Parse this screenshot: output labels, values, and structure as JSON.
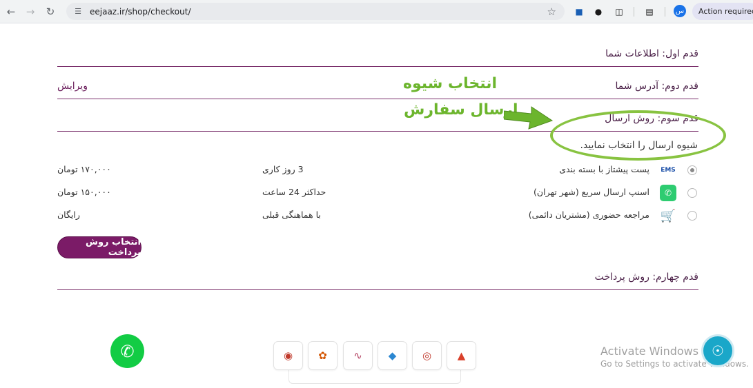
{
  "browser": {
    "url": "eejaaz.ir/shop/checkout/",
    "profile_initial": "س",
    "action_required": "Action required"
  },
  "steps": {
    "step1": "قدم اول: اطلاعات شما",
    "step2": "قدم دوم: آدرس شما",
    "step2_edit": "ویرایش",
    "step3": "قدم سوم: روش ارسال",
    "step4": "قدم چهارم: روش پرداخت"
  },
  "shipping": {
    "instruction": "شیوه ارسال را انتخاب نمایید.",
    "options": [
      {
        "name": "پست پیشتاز با بسته بندی",
        "time": "3 روز کاری",
        "price": "۱۷۰,۰۰۰ تومان",
        "selected": true,
        "icon": "post-icon"
      },
      {
        "name": "اسنپ ارسال سریع (شهر تهران)",
        "time": "حداکثر 24 ساعت",
        "price": "۱۵۰,۰۰۰ تومان",
        "selected": false,
        "icon": "snapp-icon"
      },
      {
        "name": "مراجعه حضوری (مشتریان دائمی)",
        "time": "با هماهنگی قبلی",
        "price": "رایگان",
        "selected": false,
        "icon": "cart-icon"
      }
    ],
    "pay_button": "انتخاب روش پرداخت"
  },
  "annotation": {
    "line1": "انتخاب شیوه",
    "line2": "ارسال سفارش",
    "color": "#6cb52d"
  },
  "watermark": {
    "title": "Activate Windows",
    "subtitle": "Go to Settings to activate Windows."
  }
}
